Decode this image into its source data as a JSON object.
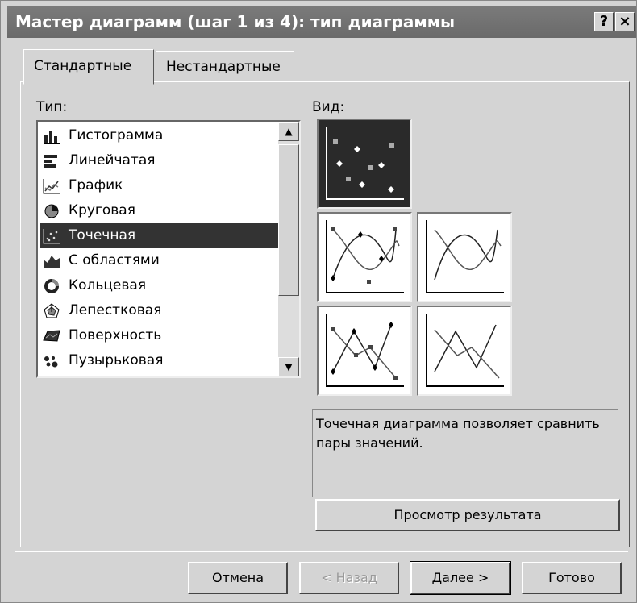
{
  "window": {
    "title": "Мастер диаграмм (шаг 1 из 4): тип диаграммы",
    "help_label": "?",
    "close_label": "×"
  },
  "tabs": [
    {
      "label": "Стандартные",
      "active": true
    },
    {
      "label": "Нестандартные",
      "active": false
    }
  ],
  "type_section": {
    "label": "Тип:",
    "items": [
      {
        "label": "Гистограмма",
        "icon": "column-chart-icon"
      },
      {
        "label": "Линейчатая",
        "icon": "bar-chart-icon"
      },
      {
        "label": "График",
        "icon": "line-chart-icon"
      },
      {
        "label": "Круговая",
        "icon": "pie-chart-icon"
      },
      {
        "label": "Точечная",
        "icon": "scatter-chart-icon",
        "selected": true
      },
      {
        "label": "С областями",
        "icon": "area-chart-icon"
      },
      {
        "label": "Кольцевая",
        "icon": "doughnut-chart-icon"
      },
      {
        "label": "Лепестковая",
        "icon": "radar-chart-icon"
      },
      {
        "label": "Поверхность",
        "icon": "surface-chart-icon"
      },
      {
        "label": "Пузырьковая",
        "icon": "bubble-chart-icon"
      }
    ]
  },
  "view_section": {
    "label": "Вид:",
    "selected_subtype": 0
  },
  "description": "Точечная диаграмма позволяет сравнить пары значений.",
  "buttons": {
    "preview": "Просмотр результата",
    "cancel": "Отмена",
    "back": "< Назад",
    "next": "Далее >",
    "finish": "Готово"
  }
}
